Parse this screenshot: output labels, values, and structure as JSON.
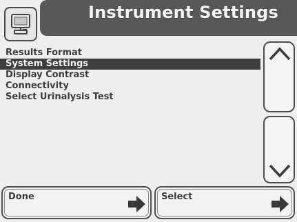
{
  "header": {
    "title": "Instrument Settings",
    "icon": "instrument-icon"
  },
  "menu": {
    "items": [
      {
        "label": "Results Format",
        "selected": false
      },
      {
        "label": "System Settings",
        "selected": true
      },
      {
        "label": "Display Contrast",
        "selected": false
      },
      {
        "label": "Connectivity",
        "selected": false
      },
      {
        "label": "Select Urinalysis Test",
        "selected": false
      }
    ]
  },
  "scroll": {
    "up_icon": "chevron-up-icon",
    "down_icon": "chevron-down-icon"
  },
  "buttons": {
    "done_label": "Done",
    "select_label": "Select",
    "arrow_icon": "arrow-right-icon"
  },
  "colors": {
    "title_bar": "#585858",
    "selected_row": "#3e3e3e",
    "background": "#eeeeee"
  }
}
